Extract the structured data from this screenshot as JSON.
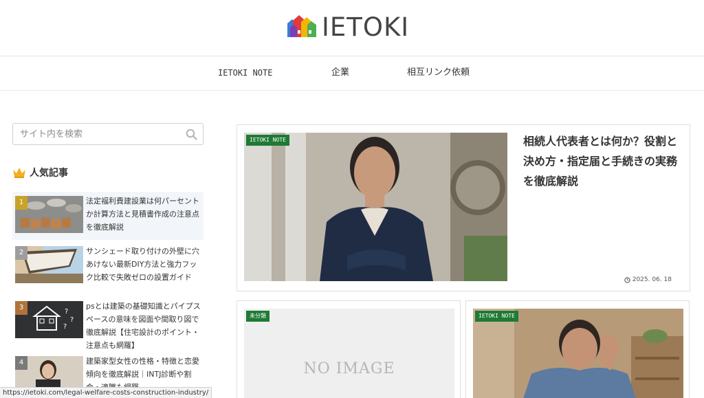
{
  "header": {
    "logo_text": "IETOKI"
  },
  "nav": {
    "items": [
      {
        "label": "IETOKI NOTE"
      },
      {
        "label": "企業"
      },
      {
        "label": "相互リンク依頼"
      }
    ]
  },
  "sidebar": {
    "search": {
      "placeholder": "サイト内を検索"
    },
    "popular": {
      "title": "人気記事",
      "items": [
        {
          "rank": "1",
          "title": "法定福利費建設業は何パーセントか計算方法と見積書作成の注意点を徹底解説",
          "rank_color": "#c9a227"
        },
        {
          "rank": "2",
          "title": "サンシェード取り付けの外壁に穴あけない最新DIY方法と強力フック比較で失敗ゼロの設置ガイド",
          "rank_color": "#9e9e9e"
        },
        {
          "rank": "3",
          "title": "psとは建築の基礎知識とパイプスペースの意味を図面や間取り図で徹底解説【住宅設計のポイント・注意点も網羅】",
          "rank_color": "#b0743b"
        },
        {
          "rank": "4",
          "title": "建築家型女性の性格・特徴と恋愛傾向を徹底解説｜INTJ診断や割合・適職も網羅",
          "rank_color": "#7a7a7a"
        }
      ]
    }
  },
  "main": {
    "featured": {
      "category": "IETOKI NOTE",
      "title": "相続人代表者とは何か？役割と決め方・指定届と手続きの実務を徹底解説",
      "date": "2025. 06. 18"
    },
    "cards": [
      {
        "category": "未分類",
        "image_text": "NO IMAGE"
      },
      {
        "category": "IETOKI NOTE"
      }
    ]
  },
  "status_bar": {
    "url": "https://ietoki.com/legal-welfare-costs-construction-industry/"
  },
  "colors": {
    "category_green": "#1f7a34",
    "rank_bg": "#f2f6fa"
  }
}
